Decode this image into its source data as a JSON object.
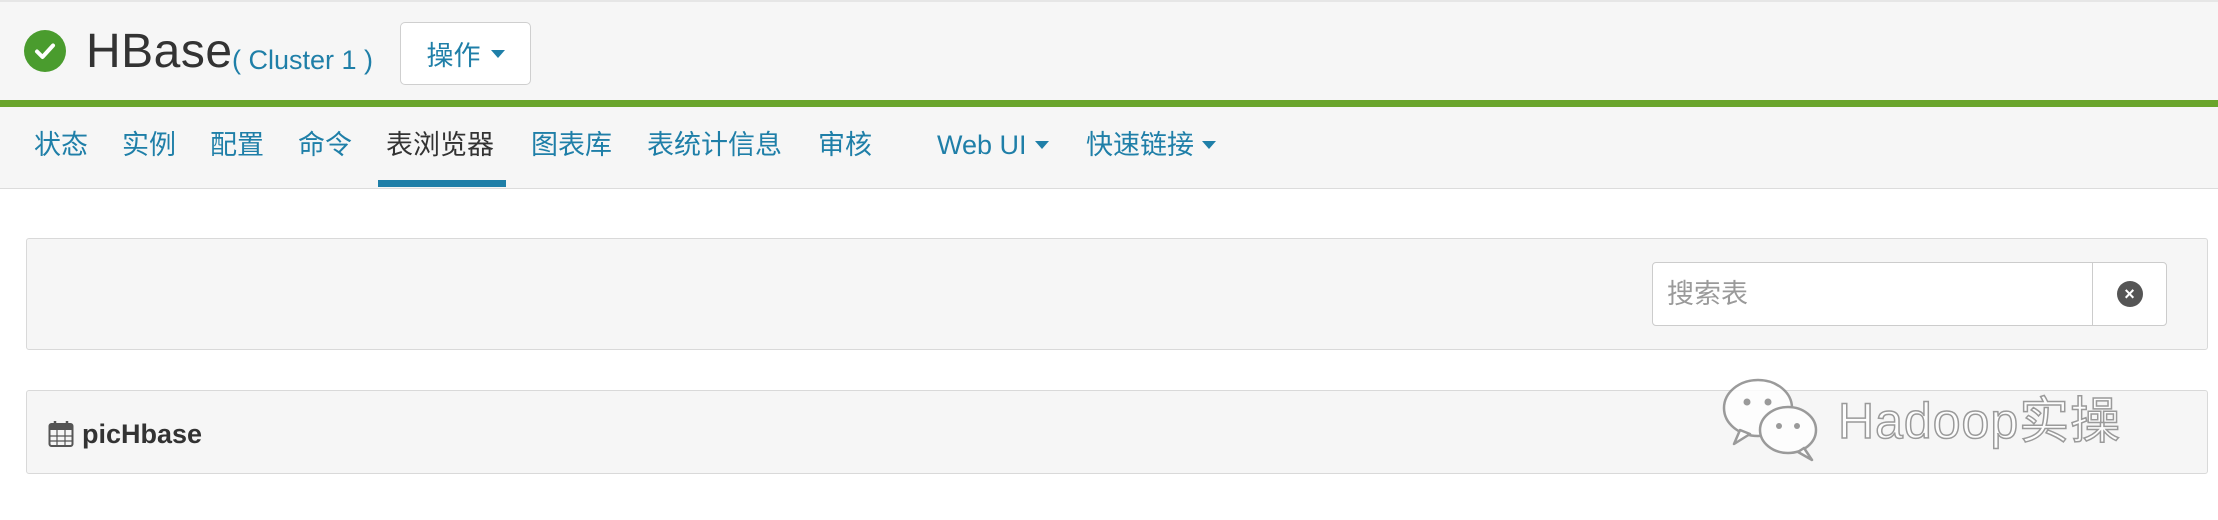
{
  "service": {
    "name": "HBase",
    "cluster": "( Cluster 1 )",
    "status_icon": "check-circle-icon",
    "status_color": "#4a9c2e"
  },
  "header": {
    "actions_label": "操作",
    "accent_color": "#6aa52c"
  },
  "tabs": [
    {
      "label": "状态",
      "active": false
    },
    {
      "label": "实例",
      "active": false
    },
    {
      "label": "配置",
      "active": false
    },
    {
      "label": "命令",
      "active": false
    },
    {
      "label": "表浏览器",
      "active": true
    },
    {
      "label": "图表库",
      "active": false
    },
    {
      "label": "表统计信息",
      "active": false
    },
    {
      "label": "审核",
      "active": false
    },
    {
      "label": "Web UI",
      "active": false,
      "dropdown": true
    },
    {
      "label": "快速链接",
      "active": false,
      "dropdown": true
    }
  ],
  "search": {
    "placeholder": "搜索表",
    "value": "",
    "clear_icon": "clear-circle-icon"
  },
  "tables": [
    {
      "name": "picHbase",
      "icon": "calendar-table-icon"
    }
  ],
  "watermark": {
    "text": "Hadoop实操",
    "icon": "wechat-icon"
  },
  "colors": {
    "link": "#1f7fa8",
    "text": "#333333",
    "background": "#f6f6f6"
  }
}
